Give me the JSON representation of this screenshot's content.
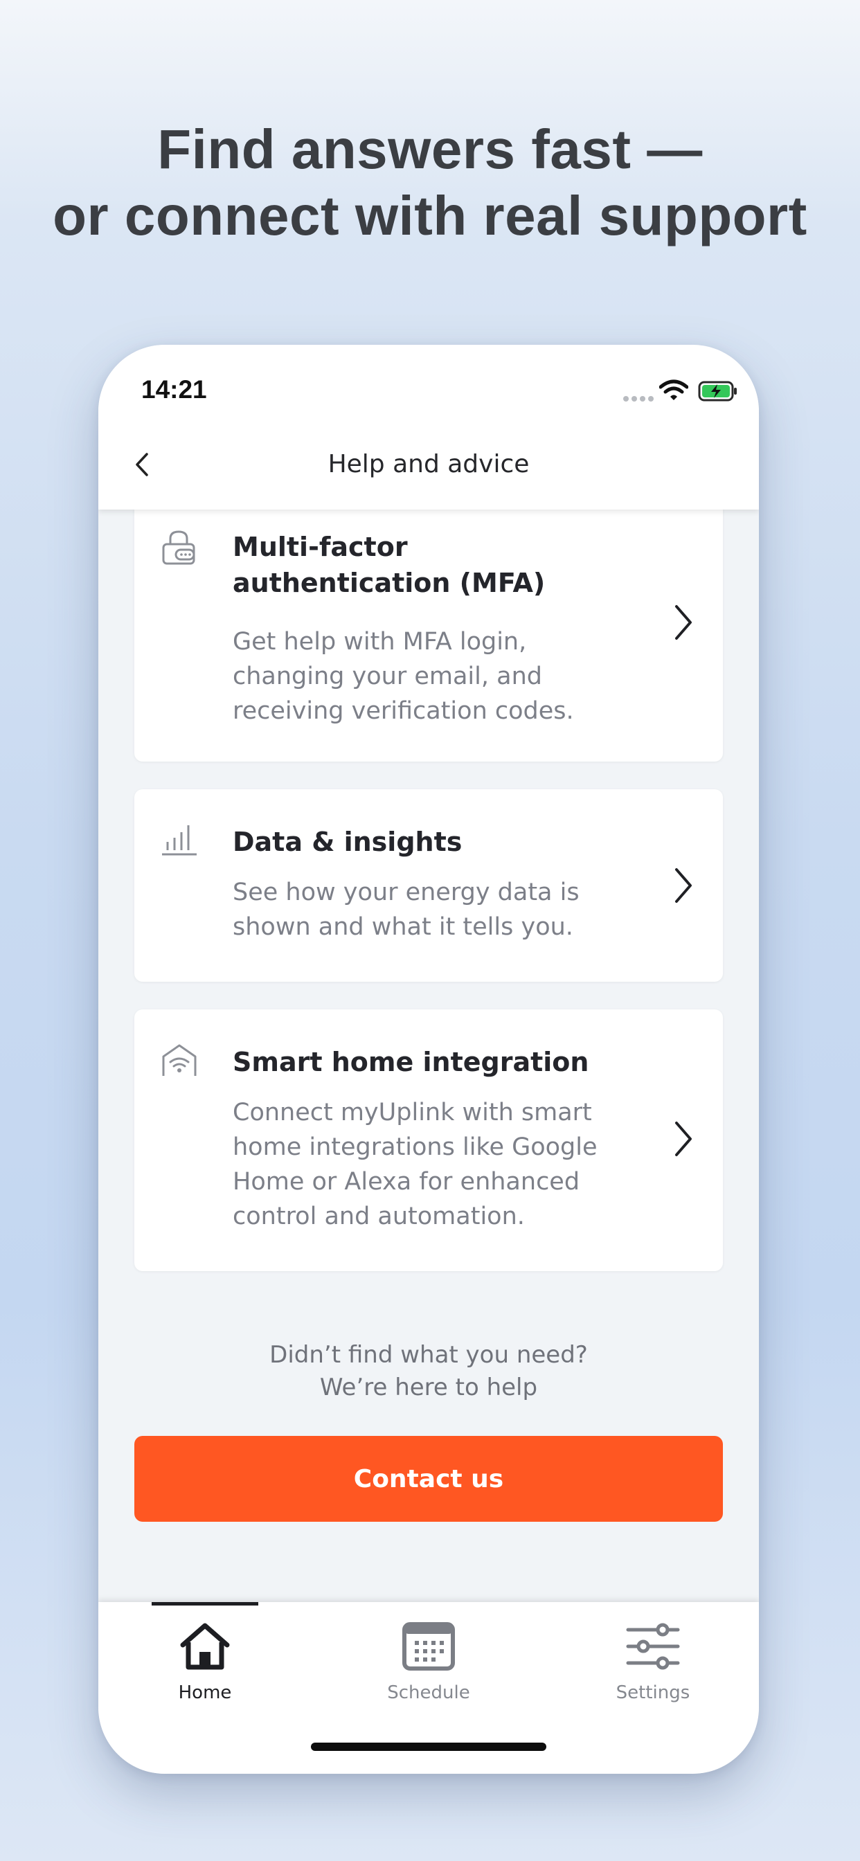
{
  "headline": {
    "line1": "Find answers fast —",
    "line2": "or connect with real support"
  },
  "status_bar": {
    "time": "14:21",
    "icons": [
      "cellular-signal-icon",
      "wifi-icon",
      "battery-charging-icon"
    ]
  },
  "nav": {
    "back_icon": "chevron-left-icon",
    "title": "Help and advice"
  },
  "cards": [
    {
      "icon": "lock-icon",
      "title_line1": "Multi-factor",
      "title_line2": "authentication (MFA)",
      "desc_lines": [
        "Get help with MFA login,",
        "changing your email, and",
        "receiving verification codes."
      ]
    },
    {
      "icon": "bar-chart-icon",
      "title": "Data & insights",
      "desc_lines": [
        "See how your energy data is",
        "shown and what it tells you."
      ]
    },
    {
      "icon": "smart-home-icon",
      "title": "Smart home integration",
      "desc_lines": [
        "Connect myUplink with smart",
        "home integrations like Google",
        "Home or Alexa for enhanced",
        "control and automation."
      ]
    }
  ],
  "help": {
    "line1": "Didn’t find what you need?",
    "line2": "We’re here to help"
  },
  "contact_button": "Contact us",
  "tabs": [
    {
      "label": "Home",
      "icon": "home-icon",
      "active": true
    },
    {
      "label": "Schedule",
      "icon": "calendar-icon",
      "active": false
    },
    {
      "label": "Settings",
      "icon": "sliders-icon",
      "active": false
    }
  ],
  "colors": {
    "accent": "#ff5722",
    "text_dark": "#24252b",
    "text_muted": "#7c7f88"
  }
}
